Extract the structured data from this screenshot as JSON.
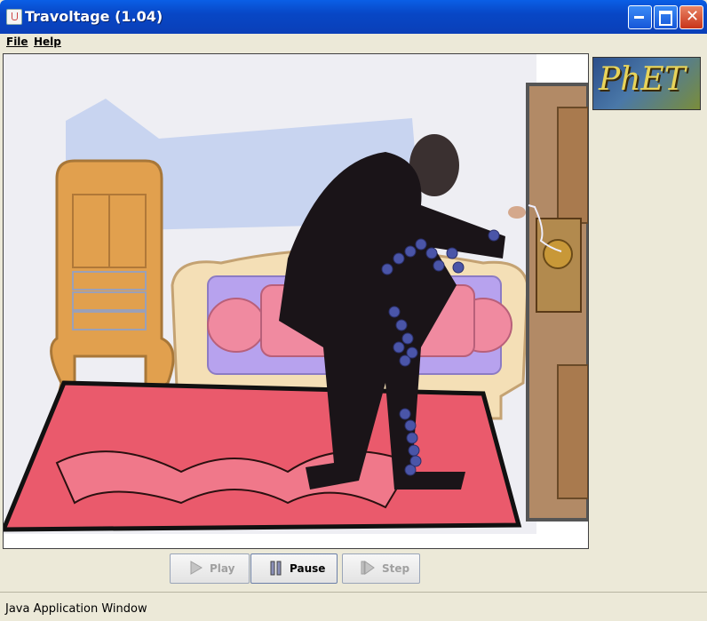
{
  "window": {
    "title": "Travoltage (1.04)"
  },
  "menu": {
    "file": "File",
    "help": "Help"
  },
  "logo": {
    "text": "PhET"
  },
  "controls": {
    "play": {
      "label": "Play",
      "enabled": false
    },
    "pause": {
      "label": "Pause",
      "enabled": true
    },
    "step": {
      "label": "Step",
      "enabled": false
    }
  },
  "status": {
    "text": "Java Application Window"
  }
}
